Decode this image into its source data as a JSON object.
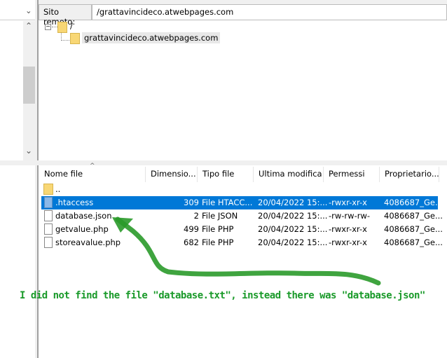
{
  "remote": {
    "label": "Sito remoto:",
    "path": "/grattavincideco.atwebpages.com"
  },
  "tree": {
    "root": "/",
    "child": "grattavincideco.atwebpages.com"
  },
  "columns": [
    "Nome file",
    "Dimensio...",
    "Tipo file",
    "Ultima modifica",
    "Permessi",
    "Proprietario..."
  ],
  "parent_dir": "..",
  "files": [
    {
      "name": ".htaccess",
      "size": "309",
      "type": "File HTACC...",
      "modified": "20/04/2022 15:...",
      "perms": "-rwxr-xr-x",
      "owner": "4086687_Ge...",
      "selected": true
    },
    {
      "name": "database.json",
      "size": "2",
      "type": "File JSON",
      "modified": "20/04/2022 15:...",
      "perms": "-rw-rw-rw-",
      "owner": "4086687_Ge..."
    },
    {
      "name": "getvalue.php",
      "size": "499",
      "type": "File PHP",
      "modified": "20/04/2022 15:...",
      "perms": "-rwxr-xr-x",
      "owner": "4086687_Ge..."
    },
    {
      "name": "storeavalue.php",
      "size": "682",
      "type": "File PHP",
      "modified": "20/04/2022 15:...",
      "perms": "-rwxr-xr-x",
      "owner": "4086687_Ge..."
    }
  ],
  "annotation": {
    "text": "I did not find the file \"database.txt\", instead there was \"database.json\"",
    "color": "#1a9a2a"
  }
}
